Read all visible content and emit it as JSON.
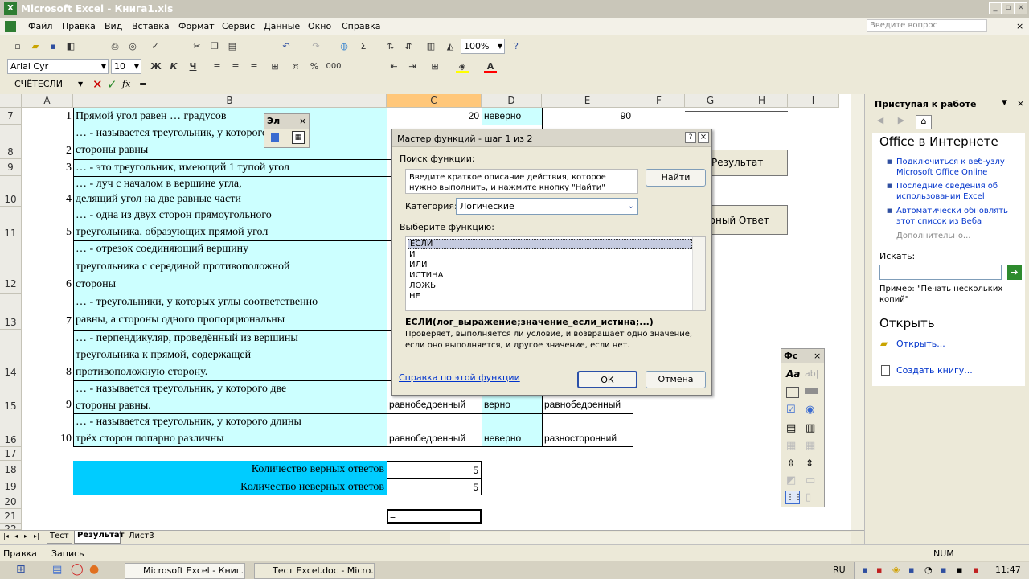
{
  "window": {
    "title": "Microsoft Excel - Книга1.xls"
  },
  "menu": {
    "items": [
      "Файл",
      "Правка",
      "Вид",
      "Вставка",
      "Формат",
      "Сервис",
      "Данные",
      "Окно",
      "Справка"
    ],
    "ask_placeholder": "Введите вопрос"
  },
  "toolbar": {
    "zoom": "100%",
    "font": "Arial Cyr",
    "size": "10",
    "bold": "Ж",
    "italic": "К",
    "underline": "Ч",
    "percent": "%",
    "thousands": "000"
  },
  "formula": {
    "name_box": "СЧЁТЕСЛИ",
    "fx": "fx",
    "eq": "="
  },
  "sheet": {
    "columns": [
      "A",
      "B",
      "C",
      "D",
      "E",
      "F",
      "G",
      "H",
      "I"
    ],
    "rows": [
      {
        "n": "7",
        "a": "1",
        "b": [
          "Прямой угол равен … градусов"
        ],
        "c": "20",
        "d": "неверно",
        "e": "90"
      },
      {
        "n": "8",
        "a": "2",
        "b": [
          "… - называется треугольник, у которого все три",
          "стороны равны"
        ]
      },
      {
        "n": "9",
        "a": "3",
        "b": [
          "… - это треугольник, имеющий 1 тупой угол"
        ]
      },
      {
        "n": "10",
        "a": "4",
        "b": [
          "… - луч с началом в вершине угла,",
          "делящий угол на две равные части"
        ]
      },
      {
        "n": "11",
        "a": "5",
        "b": [
          "… - одна из двух сторон прямоугольного",
          "треугольника, образующих прямой угол"
        ]
      },
      {
        "n": "12",
        "a": "6",
        "b": [
          "… - отрезок соединяющий вершину",
          "треугольника с серединой противоположной",
          "стороны"
        ]
      },
      {
        "n": "13",
        "a": "7",
        "b": [
          "… - треугольники, у которых углы соответственно",
          "равны, а стороны одного пропорциональны"
        ]
      },
      {
        "n": "14",
        "a": "8",
        "b": [
          "… - перпендикуляр, проведённый из вершины",
          "треугольника к прямой, содержащей",
          "противоположную сторону."
        ]
      },
      {
        "n": "15",
        "a": "9",
        "b": [
          "… - называется треугольник, у которого две",
          "стороны равны."
        ],
        "c": "равнобедренный",
        "d": "верно",
        "e": "равнобедренный"
      },
      {
        "n": "16",
        "a": "10",
        "b": [
          "… - называется треугольник, у которого длины",
          "трёх сторон попарно различны"
        ],
        "c": "равнобедренный",
        "d": "неверно",
        "e": "разносторонний"
      }
    ],
    "extra_rows": [
      "17",
      "18",
      "19",
      "20",
      "21",
      "22"
    ],
    "count_correct_label": "Количество верных ответов",
    "count_correct": "5",
    "count_wrong_label": "Количество неверных ответов",
    "count_wrong": "5",
    "edit_cell": "=",
    "btn_result": "Результат",
    "btn_answer": "ерный Ответ"
  },
  "tabs": [
    "Тест",
    "Результат",
    "Лист3"
  ],
  "status": {
    "left": "Правка",
    "mode": "Запись",
    "num": "NUM"
  },
  "taskbar": {
    "tasks": [
      "Microsoft Excel - Книг...",
      "Тест Excel.doc - Micro..."
    ],
    "lang": "RU",
    "time": "11:47"
  },
  "dialog": {
    "title": "Мастер функций - шаг 1 из 2",
    "search_label": "Поиск функции:",
    "search_text": "Введите краткое описание действия, которое нужно выполнить, и нажмите кнопку \"Найти\"",
    "find": "Найти",
    "category_label": "Категория:",
    "category": "Логические",
    "select_label": "Выберите функцию:",
    "functions": [
      "ЕСЛИ",
      "И",
      "ИЛИ",
      "ИСТИНА",
      "ЛОЖЬ",
      "НЕ"
    ],
    "signature": "ЕСЛИ(лог_выражение;значение_если_истина;...)",
    "description": "Проверяет, выполняется ли условие, и возвращает одно значение, если оно выполняется, и другое значение, если нет.",
    "help_link": "Справка по этой функции",
    "ok": "ОК",
    "cancel": "Отмена"
  },
  "floaters": {
    "small": "Эл",
    "forms": "Фс"
  },
  "taskpane": {
    "title": "Приступая к работе",
    "online_heading": "Office в Интернете",
    "links": [
      "Подключиться к веб-узлу Microsoft Office Online",
      "Последние сведения об использовании Excel",
      "Автоматически обновлять этот список из Веба"
    ],
    "more": "Дополнительно...",
    "search_label": "Искать:",
    "example": "Пример: \"Печать нескольких копий\"",
    "open_heading": "Открыть",
    "open_link": "Открыть...",
    "create_link": "Создать книгу..."
  }
}
